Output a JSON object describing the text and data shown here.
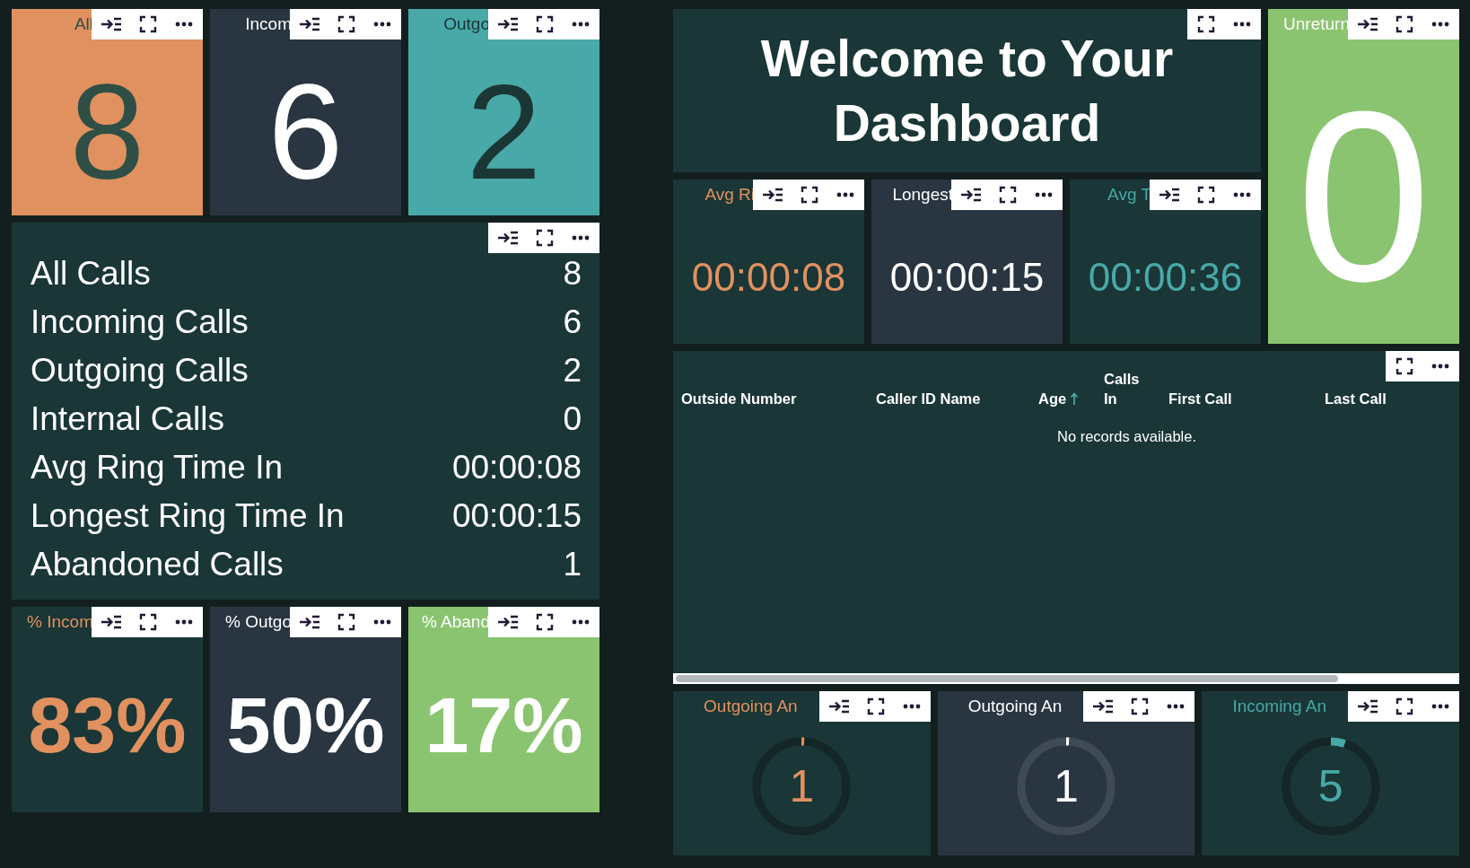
{
  "count_tiles": [
    {
      "title": "All",
      "value": "8",
      "kind": "orange",
      "color": "#2f4f46"
    },
    {
      "title": "Incom",
      "value": "6",
      "kind": "slate",
      "color": "#ffffff"
    },
    {
      "title": "Outgo",
      "value": "2",
      "kind": "teal",
      "color": "#1b3735"
    }
  ],
  "summary": {
    "rows": [
      {
        "label": "All Calls",
        "value": "8"
      },
      {
        "label": "Incoming Calls",
        "value": "6"
      },
      {
        "label": "Outgoing Calls",
        "value": "2"
      },
      {
        "label": "Internal Calls",
        "value": "0"
      },
      {
        "label": "Avg Ring Time In",
        "value": "00:00:08"
      },
      {
        "label": "Longest Ring Time In",
        "value": "00:00:15"
      },
      {
        "label": "Abandoned Calls",
        "value": "1"
      }
    ]
  },
  "percent_tiles": [
    {
      "title": "% Incom",
      "value": "83%",
      "kind": "dark",
      "color": "#e0915f"
    },
    {
      "title": "% Outgo",
      "value": "50%",
      "kind": "slate",
      "color": "#ffffff"
    },
    {
      "title": "% Aband",
      "value": "17%",
      "kind": "green",
      "color": "#ffffff"
    }
  ],
  "welcome": {
    "title": "Welcome to Your Dashboard"
  },
  "duration_tiles": [
    {
      "title": "Avg Ri",
      "value": "00:00:08",
      "kind": "dark",
      "color": "#e0915f"
    },
    {
      "title": "Longest",
      "value": "00:00:15",
      "kind": "slate",
      "color": "#ffffff"
    },
    {
      "title": "Avg T",
      "value": "00:00:36",
      "kind": "dark",
      "color": "#48a9a8"
    }
  ],
  "unreturned_tile": {
    "title": "Unreturn",
    "value": "0",
    "kind": "green",
    "color": "#ffffff"
  },
  "calls_table": {
    "columns": [
      {
        "label": "Outside Number",
        "sorted": false
      },
      {
        "label": "Caller ID Name",
        "sorted": false
      },
      {
        "label": "Age",
        "sorted": true
      },
      {
        "label": "Calls In",
        "sorted": false
      },
      {
        "label": "First Call",
        "sorted": false
      },
      {
        "label": "Last Call",
        "sorted": false
      }
    ],
    "empty_message": "No records available."
  },
  "gauges": [
    {
      "title": "Outgoing An",
      "value": "1",
      "level": 0.01,
      "kind": "dark",
      "color": "#e0915f"
    },
    {
      "title": "Outgoing An",
      "value": "1",
      "level": 0.01,
      "kind": "slate",
      "color": "#ffffff"
    },
    {
      "title": "Incoming An",
      "value": "5",
      "level": 0.05,
      "kind": "dark",
      "color": "#48a9a8"
    }
  ]
}
